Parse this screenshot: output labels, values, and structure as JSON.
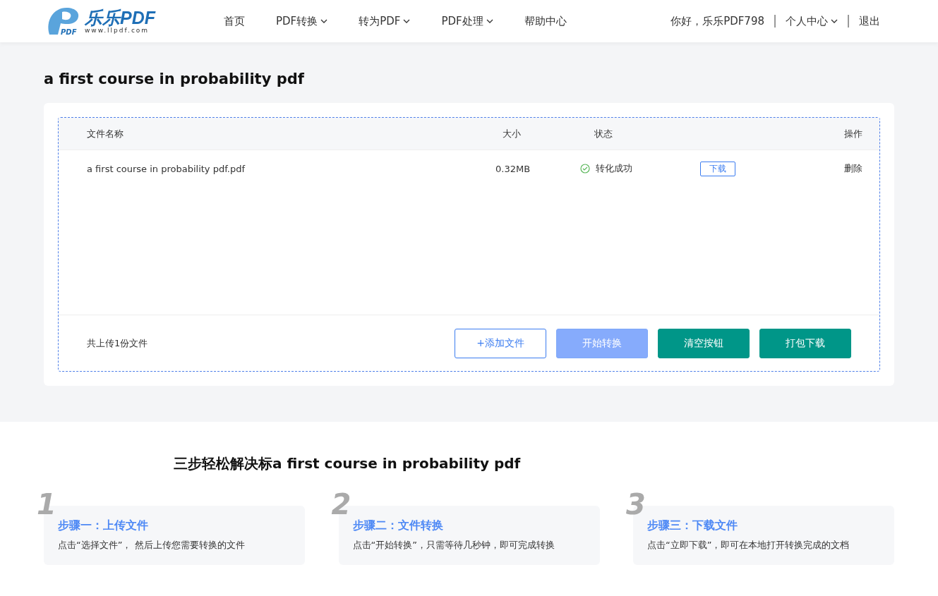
{
  "logo": {
    "mark": "PDF",
    "name": "乐乐PDF",
    "url": "www.llpdf.com"
  },
  "nav": [
    {
      "label": "首页",
      "dropdown": false
    },
    {
      "label": "PDF转换",
      "dropdown": true
    },
    {
      "label": "转为PDF",
      "dropdown": true
    },
    {
      "label": "PDF处理",
      "dropdown": true
    },
    {
      "label": "帮助中心",
      "dropdown": false
    }
  ],
  "user": {
    "greeting": "你好，乐乐PDF798",
    "center": "个人中心",
    "logout": "退出"
  },
  "page_title": "a first course in probability pdf",
  "table": {
    "columns": [
      "文件名称",
      "大小",
      "状态",
      "操作"
    ],
    "rows": [
      {
        "name": "a first course in probability pdf.pdf",
        "size": "0.32MB",
        "status": "转化成功",
        "download": "下载",
        "delete": "删除"
      }
    ]
  },
  "footer": {
    "count": "共上传1份文件",
    "buttons": [
      {
        "label": "+添加文件",
        "kind": "outline"
      },
      {
        "label": "开始转换",
        "kind": "light"
      },
      {
        "label": "清空按钮",
        "kind": "solid"
      },
      {
        "label": "打包下载",
        "kind": "solid"
      }
    ]
  },
  "steps_title": "三步轻松解决标a first course in probability pdf",
  "steps": [
    {
      "number": "1",
      "title": "步骤一：上传文件",
      "text": "点击“选择文件”， 然后上传您需要转换的文件"
    },
    {
      "number": "2",
      "title": "步骤二：文件转换",
      "text": "点击“开始转换”，只需等待几秒钟，即可完成转换"
    },
    {
      "number": "3",
      "title": "步骤三：下载文件",
      "text": "点击“立即下载”，即可在本地打开转换完成的文档"
    }
  ]
}
